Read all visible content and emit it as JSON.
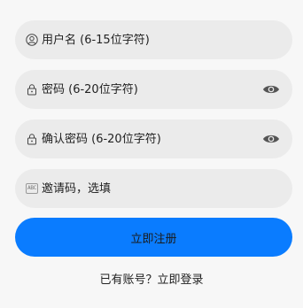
{
  "form": {
    "username": {
      "placeholder": "用户名 (6-15位字符)",
      "icon": "user-icon"
    },
    "password": {
      "placeholder": "密码 (6-20位字符)",
      "icon": "lock-icon",
      "toggle_icon": "eye-icon"
    },
    "confirm_password": {
      "placeholder": "确认密码 (6-20位字符)",
      "icon": "lock-icon",
      "toggle_icon": "eye-icon"
    },
    "invite_code": {
      "placeholder": "邀请码，选填",
      "icon": "abc-icon",
      "icon_text": "ABC"
    }
  },
  "submit_label": "立即注册",
  "login_prompt": {
    "text": "已有账号？",
    "link_label": "立即登录"
  },
  "colors": {
    "background": "#f7f7f7",
    "field_background": "#ebebeb",
    "primary": "#0a7cff"
  }
}
